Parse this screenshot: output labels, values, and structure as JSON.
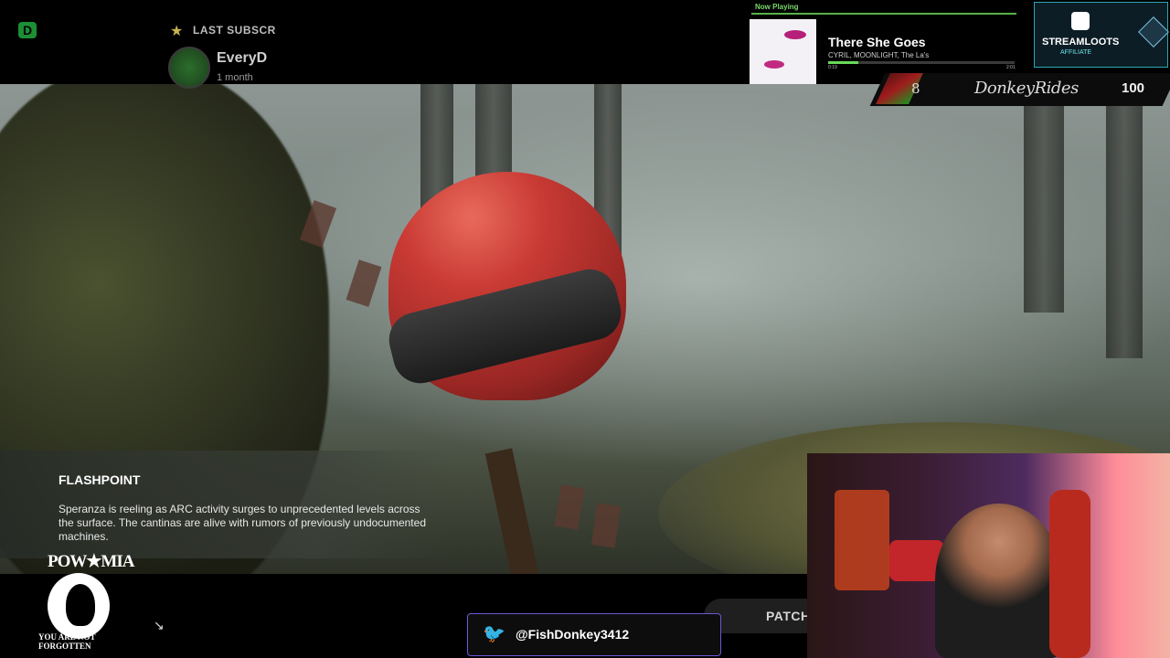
{
  "subscriber": {
    "heading": "LAST SUBSCR",
    "name": "EveryD",
    "time": "1 month"
  },
  "now_playing": {
    "label": "Now Playing",
    "title": "There She Goes",
    "artist": "CYRIL, MOONLIGHT, The La's",
    "current_time": "0:19",
    "duration": "2:01",
    "progress": 0.16
  },
  "streamloots": {
    "brand": "STREAMLOOTS",
    "tier": "AFFILIATE"
  },
  "rides": {
    "count": "8",
    "name": "DonkeyRides",
    "goal": "100"
  },
  "flashpoint": {
    "title": "FLASHPOINT",
    "body": "Speranza is reeling as ARC activity surges to unprecedented levels across the surface. The cantinas are alive with rumors of previously undocumented machines."
  },
  "pow_mia": {
    "top": "POW★MIA",
    "bottom": "YOU ARE NOT FORGOTTEN"
  },
  "social": {
    "handle": "@FishDonkey3412"
  },
  "patch": {
    "label": "PATCH"
  },
  "colors": {
    "accent_green": "#68d85a",
    "twitter_blue": "#1da1f2",
    "border_purple": "#6f57d4"
  }
}
